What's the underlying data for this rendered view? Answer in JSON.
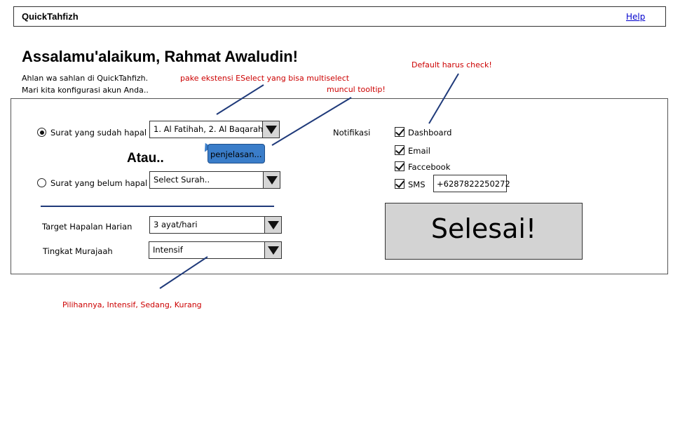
{
  "header": {
    "app_title": "QuickTahfizh",
    "help_label": "Help"
  },
  "greeting": "Assalamu'alaikum, Rahmat Awaludin!",
  "intro": [
    "Ahlan wa sahlan di QuickTahfizh.",
    "Mari kita konfigurasi akun Anda.."
  ],
  "annotations": {
    "eselect": "pake ekstensi ESelect yang bisa multiselect",
    "tooltip": "muncul tooltip!",
    "default_check": "Default harus check!",
    "choices": "Pilihannya, Intensif, Sedang, Kurang"
  },
  "form": {
    "surat_hapal": {
      "label": "Surat yang sudah hapal",
      "selected": true,
      "value": "1. Al Fatihah, 2. Al Baqarah"
    },
    "atau": "Atau..",
    "surat_belum": {
      "label": "Surat yang belum hapal",
      "selected": false,
      "placeholder": "Select Surah.."
    },
    "tooltip_text": "penjelasan...",
    "target": {
      "label": "Target Hapalan Harian",
      "value": "3 ayat/hari"
    },
    "murajaah": {
      "label": "Tingkat Murajaah",
      "value": "Intensif"
    }
  },
  "notifikasi": {
    "label": "Notifikasi",
    "options": [
      {
        "label": "Dashboard",
        "checked": true
      },
      {
        "label": "Email",
        "checked": true
      },
      {
        "label": "Faccebook",
        "checked": true
      },
      {
        "label": "SMS",
        "checked": true
      }
    ],
    "phone": "+6287822250272"
  },
  "submit_label": "Selesai!",
  "colors": {
    "tooltip_bg": "#3a7dc9",
    "annotation": "#cc0000",
    "submit_bg": "#d3d3d3",
    "divider": "#1f3a7a"
  }
}
